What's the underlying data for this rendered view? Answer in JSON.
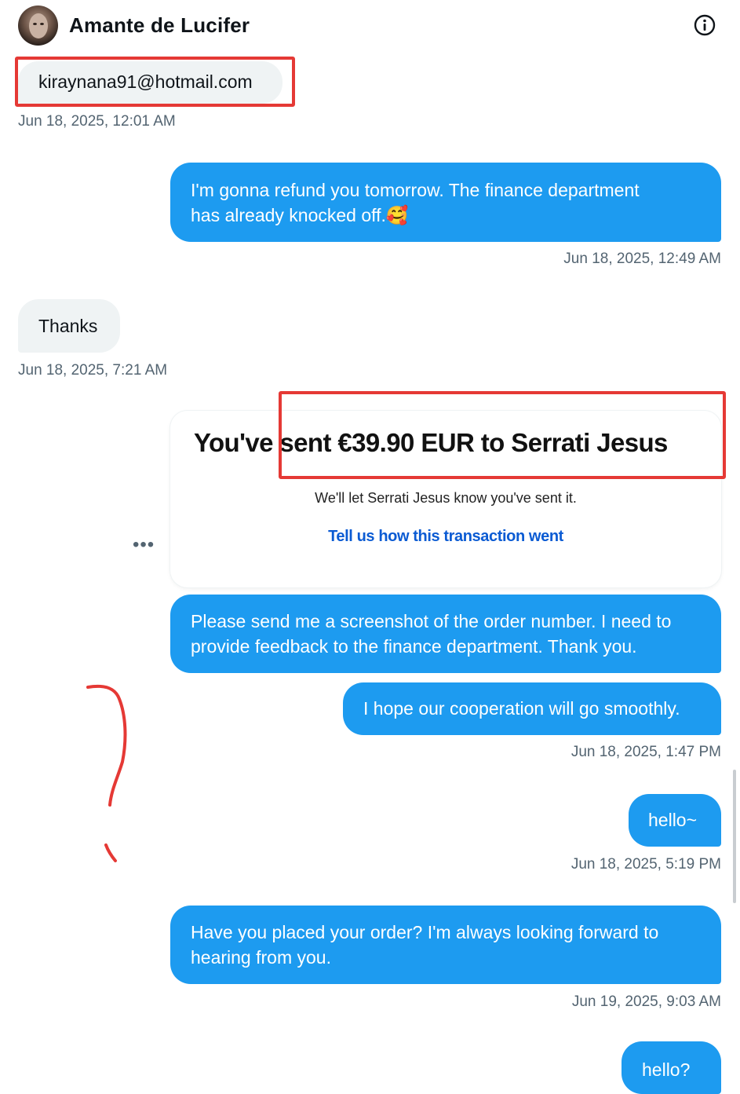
{
  "header": {
    "contact_name": "Amante de Lucifer",
    "avatar_icon": "avatar-portrait",
    "info_icon": "info-circle-icon"
  },
  "messages": [
    {
      "id": "m1",
      "direction": "in",
      "text": "kiraynana91@hotmail.com",
      "timestamp": "Jun 18, 2025, 12:01 AM"
    },
    {
      "id": "m2",
      "direction": "out",
      "lines": [
        "I'm gonna refund you tomorrow. The finance department",
        "has already knocked off.🥰"
      ],
      "timestamp": "Jun 18, 2025, 12:49 AM"
    },
    {
      "id": "m3",
      "direction": "in",
      "text": "Thanks",
      "timestamp": "Jun 18, 2025, 7:21 AM"
    },
    {
      "id": "m4",
      "direction": "out",
      "type": "image-card",
      "card": {
        "headline": "You've sent €39.90 EUR to Serrati Jesus",
        "subtext": "We'll let Serrati Jesus know you've sent it.",
        "link": "Tell us how this transaction went"
      }
    },
    {
      "id": "m5",
      "direction": "out",
      "lines": [
        "Please send me a screenshot of the order number. I need to",
        "provide feedback to the finance department. Thank you."
      ]
    },
    {
      "id": "m6",
      "direction": "out",
      "text": "I hope our cooperation will go smoothly.",
      "timestamp": "Jun 18, 2025, 1:47 PM"
    },
    {
      "id": "m7",
      "direction": "out",
      "text": "hello~",
      "timestamp": "Jun 18, 2025, 5:19 PM"
    },
    {
      "id": "m8",
      "direction": "out",
      "lines": [
        "Have you placed your order? I'm always looking forward to",
        "hearing from you."
      ],
      "timestamp": "Jun 19, 2025, 9:03 AM"
    },
    {
      "id": "m9",
      "direction": "out",
      "text": "hello?"
    }
  ],
  "more_options_label": "•••",
  "colors": {
    "outgoing_bubble": "#1d9bf0",
    "incoming_bubble": "#eff3f4",
    "timestamp": "#536471",
    "annotation_red": "#e53935",
    "link_blue": "#0b5bd3"
  }
}
